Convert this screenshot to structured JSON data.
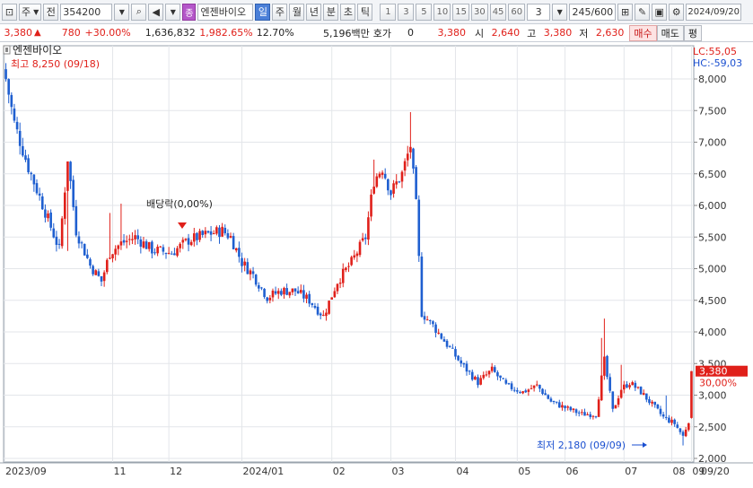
{
  "toolbar": {
    "market": "주",
    "period_btn": "전",
    "code": "354200",
    "stock_name": "엔젠바이오",
    "name_badge": "종",
    "periods": [
      "일",
      "주",
      "월",
      "년",
      "분",
      "초",
      "틱"
    ],
    "intervals": [
      "1",
      "3",
      "5",
      "10",
      "15",
      "30",
      "45",
      "60"
    ],
    "interval_input": "3",
    "count": "245",
    "count_total": "/600",
    "date": "2024/09/20"
  },
  "info": {
    "price": "3,380",
    "change": "780",
    "change_pct": "+30.00%",
    "volume": "1,636,832",
    "volume_pct": "1,982.65%",
    "turnover": "12.70%",
    "amount": "5,196백만",
    "quote_label": "호가",
    "quote_value": "0",
    "ask": "3,380",
    "open_label": "시",
    "open": "2,640",
    "high_label": "고",
    "high": "3,380",
    "low_label": "저",
    "low": "2,630",
    "buy": "매수",
    "sell": "매도",
    "eval": "평"
  },
  "chart_data": {
    "type": "candlestick",
    "title": "엔젠바이오",
    "stat_lc": "LC:55,05",
    "stat_hc": "HC:-59,03",
    "annotations": {
      "high": "최고 8,250 (09/18)",
      "low": "최저 2,180 (09/09)",
      "dividend": "배당락(0,00%)"
    },
    "last_price": "3,380",
    "last_pct": "30,00%",
    "ylim": [
      2000,
      8300
    ],
    "y_ticks": [
      "8,000",
      "7,500",
      "7,000",
      "6,500",
      "6,000",
      "5,500",
      "5,000",
      "4,500",
      "4,000",
      "3,500",
      "3,000",
      "2,500",
      "2,000"
    ],
    "x_ticks": [
      "2023/09",
      "11",
      "12",
      "2024/01",
      "02",
      "03",
      "04",
      "05",
      "06",
      "07",
      "08",
      "09",
      "09/20"
    ],
    "keypoints": [
      {
        "x": 0,
        "y": 8000
      },
      {
        "x": 3,
        "y": 7300
      },
      {
        "x": 8,
        "y": 6600
      },
      {
        "x": 14,
        "y": 5900
      },
      {
        "x": 19,
        "y": 5300
      },
      {
        "x": 22,
        "y": 6750
      },
      {
        "x": 25,
        "y": 5600
      },
      {
        "x": 30,
        "y": 5050
      },
      {
        "x": 34,
        "y": 4800
      },
      {
        "x": 37,
        "y": 5250
      },
      {
        "x": 41,
        "y": 5400
      },
      {
        "x": 46,
        "y": 5500
      },
      {
        "x": 52,
        "y": 5300
      },
      {
        "x": 59,
        "y": 5250
      },
      {
        "x": 65,
        "y": 5450
      },
      {
        "x": 72,
        "y": 5550
      },
      {
        "x": 77,
        "y": 5600
      },
      {
        "x": 80,
        "y": 5500
      },
      {
        "x": 84,
        "y": 5100
      },
      {
        "x": 88,
        "y": 4900
      },
      {
        "x": 93,
        "y": 4550
      },
      {
        "x": 98,
        "y": 4650
      },
      {
        "x": 103,
        "y": 4650
      },
      {
        "x": 108,
        "y": 4500
      },
      {
        "x": 113,
        "y": 4250
      },
      {
        "x": 118,
        "y": 4800
      },
      {
        "x": 123,
        "y": 5100
      },
      {
        "x": 128,
        "y": 5500
      },
      {
        "x": 131,
        "y": 6400
      },
      {
        "x": 134,
        "y": 6600
      },
      {
        "x": 137,
        "y": 6200
      },
      {
        "x": 141,
        "y": 6500
      },
      {
        "x": 144,
        "y": 6950
      },
      {
        "x": 146,
        "y": 6000
      },
      {
        "x": 148,
        "y": 4300
      },
      {
        "x": 152,
        "y": 4100
      },
      {
        "x": 157,
        "y": 3800
      },
      {
        "x": 162,
        "y": 3500
      },
      {
        "x": 168,
        "y": 3200
      },
      {
        "x": 173,
        "y": 3400
      },
      {
        "x": 178,
        "y": 3150
      },
      {
        "x": 184,
        "y": 3050
      },
      {
        "x": 189,
        "y": 3150
      },
      {
        "x": 194,
        "y": 2900
      },
      {
        "x": 199,
        "y": 2800
      },
      {
        "x": 205,
        "y": 2700
      },
      {
        "x": 210,
        "y": 2700
      },
      {
        "x": 213,
        "y": 3550
      },
      {
        "x": 216,
        "y": 2750
      },
      {
        "x": 219,
        "y": 3100
      },
      {
        "x": 222,
        "y": 3200
      },
      {
        "x": 226,
        "y": 3050
      },
      {
        "x": 230,
        "y": 2850
      },
      {
        "x": 234,
        "y": 2650
      },
      {
        "x": 238,
        "y": 2550
      },
      {
        "x": 241,
        "y": 2350
      },
      {
        "x": 243,
        "y": 2600
      },
      {
        "x": 244,
        "y": 3380
      }
    ]
  }
}
